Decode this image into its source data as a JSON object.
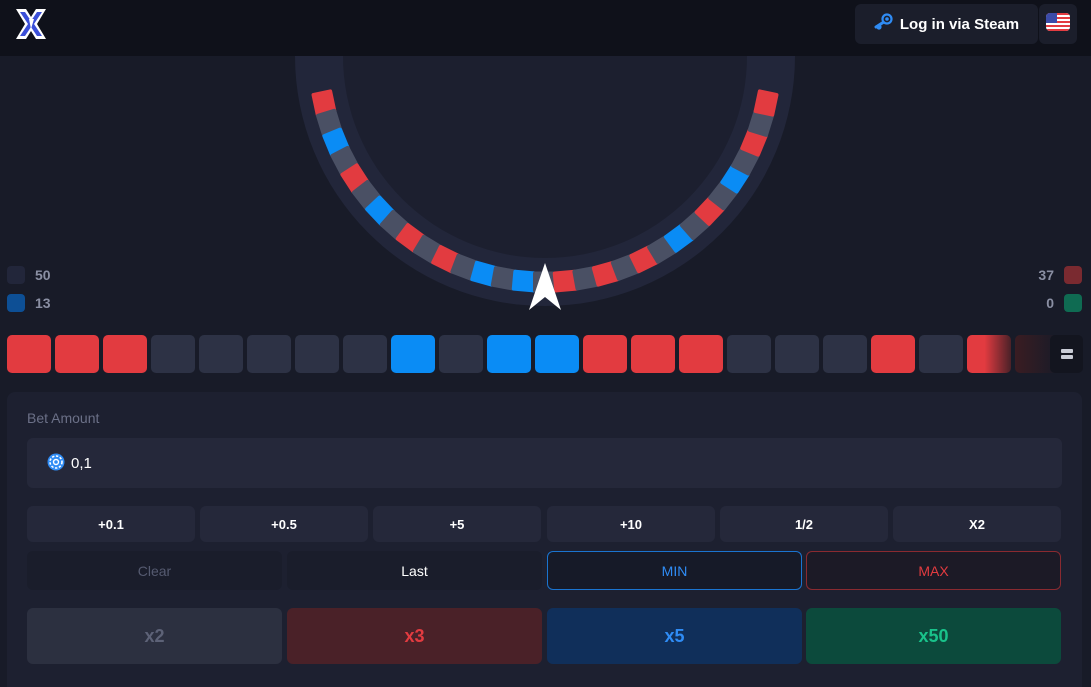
{
  "header": {
    "login_label": "Log in via Steam",
    "brand_color": "#3b6fff"
  },
  "wheel": {
    "segments": [
      "red",
      "gray",
      "blue",
      "gray",
      "red",
      "gray",
      "blue",
      "gray",
      "red",
      "gray",
      "red",
      "gray",
      "blue",
      "gray",
      "blue",
      "gray",
      "red",
      "gray",
      "red",
      "gray",
      "red",
      "gray",
      "blue",
      "gray",
      "red",
      "gray",
      "blue",
      "gray",
      "red",
      "gray",
      "red"
    ],
    "pointer_color": "#ffffff"
  },
  "stats": {
    "gray_count": "50",
    "blue_count": "13",
    "red_count": "37",
    "green_count": "0"
  },
  "history": [
    "red",
    "red",
    "red",
    "gray",
    "gray",
    "gray",
    "gray",
    "gray",
    "blue",
    "gray",
    "blue",
    "blue",
    "red",
    "red",
    "red",
    "gray",
    "gray",
    "gray",
    "red",
    "gray",
    "red",
    "red"
  ],
  "bet": {
    "label": "Bet Amount",
    "value": "0,1",
    "quick": [
      "+0.1",
      "+0.5",
      "+5",
      "+10",
      "1/2",
      "X2"
    ],
    "clear_label": "Clear",
    "last_label": "Last",
    "min_label": "MIN",
    "max_label": "MAX"
  },
  "multipliers": {
    "x2": "x2",
    "x3": "x3",
    "x5": "x5",
    "x50": "x50"
  },
  "colors": {
    "red": "#e23b40",
    "blue": "#0a8cf5",
    "gray": "#2d3245",
    "green": "#0f6b52",
    "wheel_gray": "#4a5064"
  }
}
